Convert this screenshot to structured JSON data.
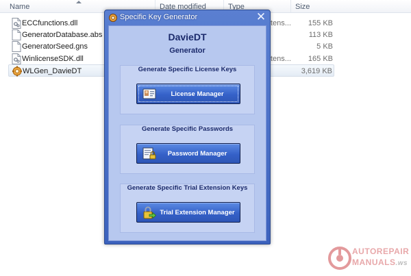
{
  "explorer": {
    "columns": {
      "name": "Name",
      "date_modified": "Date modified",
      "type": "Type",
      "size": "Size"
    },
    "files": [
      {
        "name": "ECCfunctions.dll",
        "type": "tens...",
        "size": "155 KB",
        "icon": "dll-file-icon"
      },
      {
        "name": "GeneratorDatabase.abs",
        "type": "",
        "size": "113 KB",
        "icon": "document-file-icon"
      },
      {
        "name": "GeneratorSeed.gns",
        "type": "",
        "size": "5 KB",
        "icon": "document-file-icon"
      },
      {
        "name": "WinlicenseSDK.dll",
        "type": "tens...",
        "size": "165 KB",
        "icon": "dll-file-icon"
      },
      {
        "name": "WLGen_DavieDT",
        "type": "",
        "size": "3,619 KB",
        "icon": "application-gear-icon",
        "selected": true
      }
    ]
  },
  "dialog": {
    "title": "Specific Key Generator",
    "app_name": "DavieDT",
    "app_subtitle": "Generator",
    "groups": [
      {
        "title": "Generate Specific License Keys",
        "button_label": "License Manager",
        "icon": "license-card-icon"
      },
      {
        "title": "Generate Specific Passwords",
        "button_label": "Password Manager",
        "icon": "password-document-icon"
      },
      {
        "title": "Generate Specific Trial Extension Keys",
        "button_label": "Trial Extension Manager",
        "icon": "lock-arrow-icon"
      }
    ],
    "close_glyph": "✕"
  },
  "watermark": {
    "line1": "AUTOREPAIR",
    "line2": "MANUALS",
    "tld": ".ws"
  },
  "colors": {
    "window_frame": "#4a6fc9",
    "client_bg": "#b7c8ef",
    "button_blue": "#3561c8",
    "heading_navy": "#1b2a6b"
  }
}
